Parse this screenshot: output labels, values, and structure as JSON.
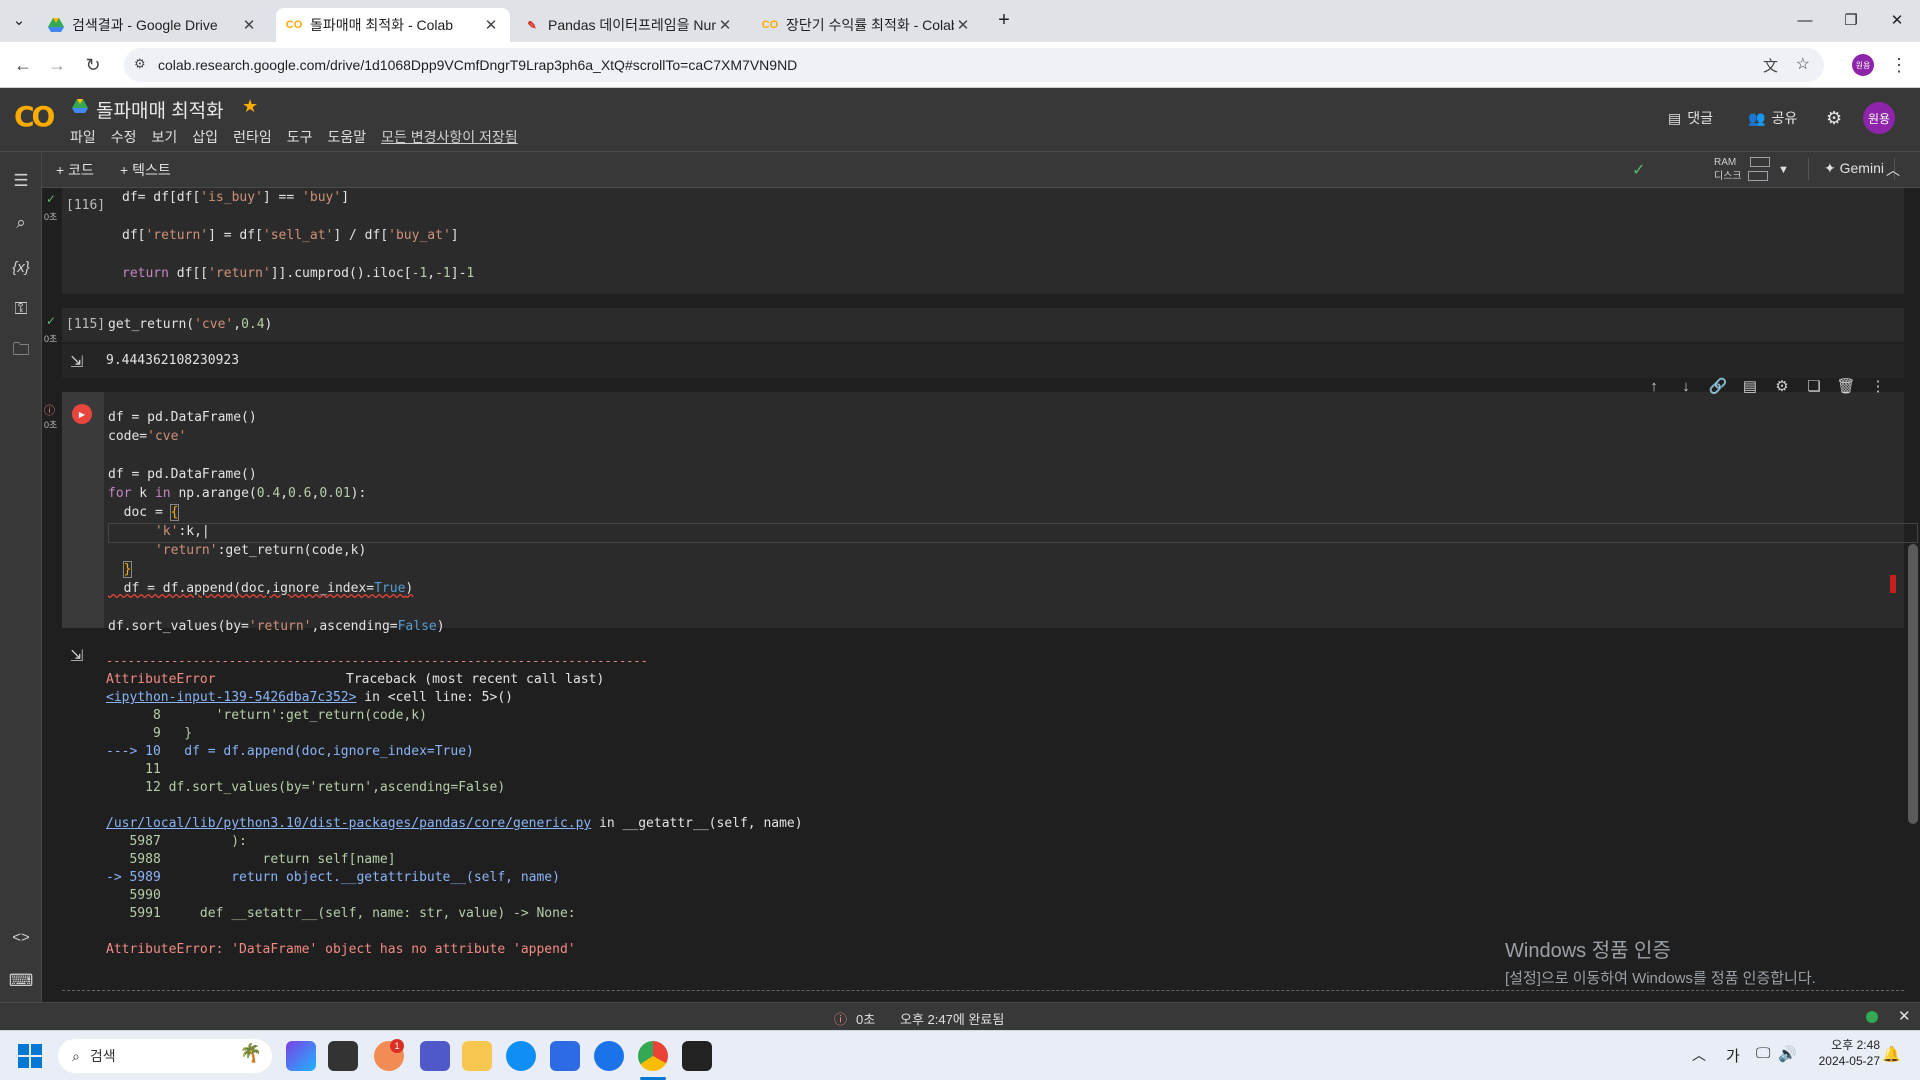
{
  "browser": {
    "tabs": [
      {
        "title": "검색결과 - Google Drive",
        "favicon": "drive-icon"
      },
      {
        "title": "돌파매매 최적화 - Colab",
        "favicon": "colab-icon"
      },
      {
        "title": "Pandas 데이터프레임을 NumP",
        "favicon": "pen-icon"
      },
      {
        "title": "장단기 수익률 최적화 - Colab",
        "favicon": "colab-icon"
      }
    ],
    "new_tab": "+",
    "url": "colab.research.google.com/drive/1d1068Dpp9VCmfDngrT9Lrap3ph6a_XtQ#scrollTo=caC7XM7VN9ND",
    "profile_initials": "원용"
  },
  "colab": {
    "logo_text": "CO",
    "notebook_title": "돌파매매 최적화",
    "menu": [
      "파일",
      "수정",
      "보기",
      "삽입",
      "런타임",
      "도구",
      "도움말"
    ],
    "saved_status": "모든 변경사항이 저장됨",
    "comments_label": "댓글",
    "share_label": "공유",
    "avatar": "원용",
    "add_code": "+ 코드",
    "add_text": "+ 텍스트",
    "ram_label": "RAM",
    "disk_label": "디스크",
    "gemini_label": "Gemini"
  },
  "cells": {
    "c116_exec": "[116]",
    "c116_time": "0초",
    "c116_lines": [
      "df= df[df['is_buy'] == 'buy']",
      "df['return'] = df['sell_at'] / df['buy_at']",
      "return df[['return']].cumprod().iloc[-1,-1]-1"
    ],
    "c115_exec": "[115]",
    "c115_time": "0초",
    "c115_code": "get_return('cve',0.4)",
    "c115_output": "9.444362108230923",
    "c139_time": "0초",
    "tb": {
      "dashes": "---------------------------------------------------------------------------",
      "err_name": "AttributeError",
      "tb_header": "Traceback (most recent call last)",
      "input_link": "<ipython-input-139-5426dba7c352>",
      "in_cell": " in <cell line: 5>()",
      "l8": "      8       'return':get_return(code,k)",
      "l9": "      9   }",
      "l10": "---> 10   df = df.append(doc,ignore_index=True)",
      "l11": "     11",
      "l12": "     12 df.sort_values(by='return',ascending=False)",
      "generic_link": "/usr/local/lib/python3.10/dist-packages/pandas/core/generic.py",
      "getattr": " in __getattr__(self, name)",
      "g5987": "   5987         ):",
      "g5988": "   5988             return self[name]",
      "g5989": "-> 5989         return object.__getattribute__(self, name)",
      "g5990": "   5990",
      "g5991": "   5991     def __setattr__(self, name: str, value) -> None:",
      "final_err": "AttributeError: 'DataFrame' object has no attribute 'append'"
    }
  },
  "status": {
    "elapsed": "0초",
    "completed": "오후 2:47에 완료됨"
  },
  "watermark": {
    "title": "Windows 정품 인증",
    "subtitle": "[설정]으로 이동하여 Windows를 정품 인증합니다."
  },
  "taskbar": {
    "search_placeholder": "검색",
    "lang": "가",
    "time": "오후 2:48",
    "date": "2024-05-27",
    "notif_badge": "1"
  }
}
